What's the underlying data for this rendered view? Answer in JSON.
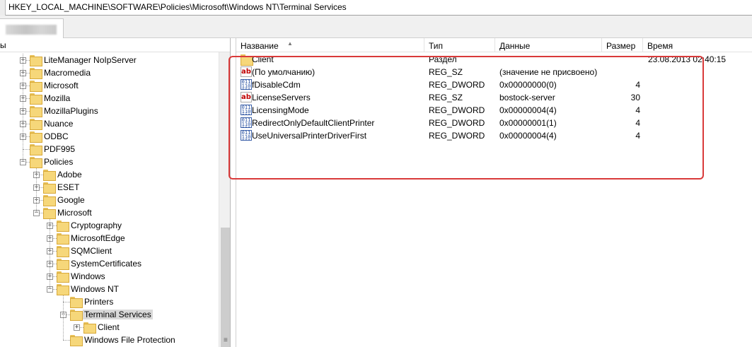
{
  "address_bar": {
    "path": "HKEY_LOCAL_MACHINE\\SOFTWARE\\Policies\\Microsoft\\Windows NT\\Terminal Services"
  },
  "tree": {
    "header": "ы",
    "items": [
      {
        "label": "LiteManager NoIpServer",
        "expander": "+"
      },
      {
        "label": "Macromedia",
        "expander": "+"
      },
      {
        "label": "Microsoft",
        "expander": "+"
      },
      {
        "label": "Mozilla",
        "expander": "+"
      },
      {
        "label": "MozillaPlugins",
        "expander": "+"
      },
      {
        "label": "Nuance",
        "expander": "+"
      },
      {
        "label": "ODBC",
        "expander": "+"
      },
      {
        "label": "PDF995",
        "expander": ""
      },
      {
        "label": "Policies",
        "expander": "−"
      },
      {
        "label": "Adobe",
        "expander": "+"
      },
      {
        "label": "ESET",
        "expander": "+"
      },
      {
        "label": "Google",
        "expander": "+"
      },
      {
        "label": "Microsoft",
        "expander": "−"
      },
      {
        "label": "Cryptography",
        "expander": "+"
      },
      {
        "label": "MicrosoftEdge",
        "expander": "+"
      },
      {
        "label": "SQMClient",
        "expander": "+"
      },
      {
        "label": "SystemCertificates",
        "expander": "+"
      },
      {
        "label": "Windows",
        "expander": "+"
      },
      {
        "label": "Windows NT",
        "expander": "−"
      },
      {
        "label": "Printers",
        "expander": ""
      },
      {
        "label": "Terminal Services",
        "expander": "−"
      },
      {
        "label": "Client",
        "expander": "+"
      },
      {
        "label": "Windows File Protection",
        "expander": ""
      }
    ]
  },
  "list": {
    "columns": {
      "name": "Название",
      "type": "Тип",
      "data": "Данные",
      "size": "Размер",
      "time": "Время"
    },
    "rows": [
      {
        "icon": "folder-icon",
        "name": "Client",
        "type": "Раздел",
        "data": "",
        "size": "",
        "time": "23.08.2013 02:40:15"
      },
      {
        "icon": "string-value-icon",
        "name": "(По умолчанию)",
        "type": "REG_SZ",
        "data": "(значение не присвоено)",
        "size": "",
        "time": ""
      },
      {
        "icon": "binary-value-icon",
        "name": "fDisableCdm",
        "type": "REG_DWORD",
        "data": "0x00000000(0)",
        "size": "4",
        "time": ""
      },
      {
        "icon": "string-value-icon",
        "name": "LicenseServers",
        "type": "REG_SZ",
        "data": "bostock-server",
        "size": "30",
        "time": ""
      },
      {
        "icon": "binary-value-icon",
        "name": "LicensingMode",
        "type": "REG_DWORD",
        "data": "0x00000004(4)",
        "size": "4",
        "time": ""
      },
      {
        "icon": "binary-value-icon",
        "name": "RedirectOnlyDefaultClientPrinter",
        "type": "REG_DWORD",
        "data": "0x00000001(1)",
        "size": "4",
        "time": ""
      },
      {
        "icon": "binary-value-icon",
        "name": "UseUniversalPrinterDriverFirst",
        "type": "REG_DWORD",
        "data": "0x00000004(4)",
        "size": "4",
        "time": ""
      }
    ]
  },
  "colors": {
    "highlight_box": "#d93a3a",
    "folder": "#f6d77a",
    "selected_bg": "#d9d9d9"
  }
}
